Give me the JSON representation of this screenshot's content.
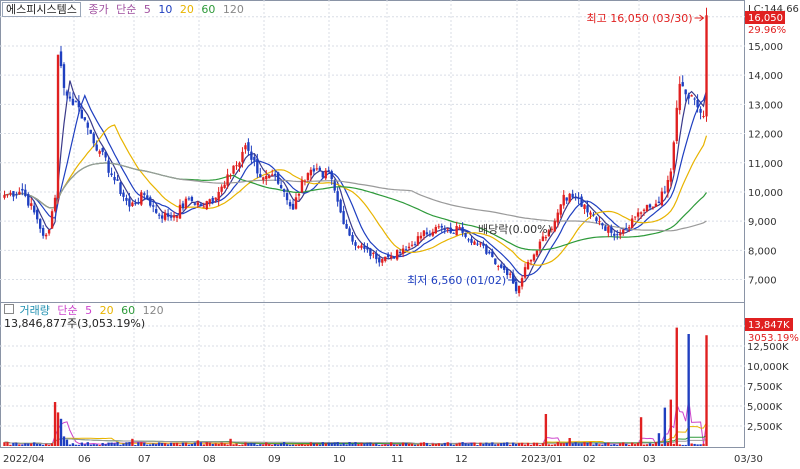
{
  "stock_name": "에스피시스템스",
  "price_legend": {
    "label": "종가",
    "kind": "단순",
    "periods": [
      "5",
      "10",
      "20",
      "60",
      "120"
    ]
  },
  "volume_legend": {
    "label": "거래량",
    "kind": "단순",
    "periods": [
      "5",
      "20",
      "60",
      "120"
    ],
    "summary": "13,846,877주(3,053.19%)"
  },
  "colors": {
    "up": "#e02020",
    "down": "#1f3fc0",
    "ma5": "#3a3a8a",
    "ma10": "#1f3fc0",
    "ma20": "#e8b400",
    "ma60": "#2e9a3a",
    "ma120": "#9a9a9a",
    "vma5": "#cc44cc",
    "vma20": "#e8b400",
    "vma60": "#2e9a3a",
    "vma120": "#9a9a9a"
  },
  "annotations": {
    "high": "최고 16,050 (03/30)",
    "low": "최저 6,560 (01/02)",
    "dividend": "배당락(0.00%)",
    "lc_tag": "LC:144.66",
    "price_tag": "16,050",
    "pct_tag": "29.96%",
    "vol_tag": "13,847K",
    "vol_pct_tag": "3053.19%"
  },
  "chart_data": {
    "type": "candlestick",
    "x_labels": [
      "2022/04",
      "06",
      "07",
      "08",
      "09",
      "10",
      "11",
      "12",
      "2023/01",
      "02",
      "03",
      "03/30"
    ],
    "price_axis": {
      "ticks": [
        "16,000",
        "15,000",
        "14,000",
        "13,000",
        "12,000",
        "11,000",
        "10,000",
        "9,000",
        "8,000",
        "7,000"
      ],
      "ylim": [
        6300,
        16300
      ]
    },
    "volume_axis": {
      "ticks": [
        "15,000K",
        "12,500K",
        "10,000K",
        "7,500K",
        "5,000K",
        "2,500K"
      ],
      "ylim": [
        0,
        16000
      ]
    },
    "close_anchors": [
      [
        0,
        9900
      ],
      [
        6,
        10050
      ],
      [
        10,
        9300
      ],
      [
        13,
        8500
      ],
      [
        15,
        8700
      ],
      [
        17,
        9800
      ],
      [
        18,
        14700
      ],
      [
        21,
        13300
      ],
      [
        25,
        12900
      ],
      [
        28,
        12200
      ],
      [
        32,
        11400
      ],
      [
        37,
        10400
      ],
      [
        42,
        9500
      ],
      [
        47,
        9900
      ],
      [
        52,
        9200
      ],
      [
        57,
        9200
      ],
      [
        62,
        9750
      ],
      [
        67,
        9500
      ],
      [
        72,
        10000
      ],
      [
        75,
        10600
      ],
      [
        77,
        10900
      ],
      [
        79,
        11000
      ],
      [
        81,
        11600
      ],
      [
        83,
        11100
      ],
      [
        86,
        10500
      ],
      [
        90,
        10600
      ],
      [
        94,
        10000
      ],
      [
        97,
        9400
      ],
      [
        100,
        10400
      ],
      [
        104,
        10700
      ],
      [
        107,
        10500
      ],
      [
        109,
        10700
      ],
      [
        113,
        9300
      ],
      [
        117,
        8300
      ],
      [
        121,
        8050
      ],
      [
        125,
        7700
      ],
      [
        130,
        7800
      ],
      [
        135,
        8000
      ],
      [
        140,
        8500
      ],
      [
        145,
        8800
      ],
      [
        150,
        8600
      ],
      [
        153,
        8800
      ],
      [
        158,
        8300
      ],
      [
        163,
        7900
      ],
      [
        167,
        7400
      ],
      [
        170,
        7200
      ],
      [
        172,
        6600
      ],
      [
        176,
        7600
      ],
      [
        180,
        8300
      ],
      [
        185,
        9000
      ],
      [
        188,
        9900
      ],
      [
        192,
        9800
      ],
      [
        196,
        9300
      ],
      [
        200,
        9000
      ],
      [
        204,
        8600
      ],
      [
        208,
        8700
      ],
      [
        213,
        9300
      ],
      [
        218,
        9500
      ],
      [
        222,
        10000
      ],
      [
        224,
        10700
      ],
      [
        227,
        13700
      ],
      [
        230,
        13200
      ],
      [
        233,
        12900
      ],
      [
        235,
        12600
      ],
      [
        236,
        16050
      ]
    ],
    "volume_spikes_k": [
      [
        17,
        5500
      ],
      [
        18,
        4200
      ],
      [
        19,
        3400
      ],
      [
        20,
        1200
      ],
      [
        21,
        800
      ],
      [
        43,
        900
      ],
      [
        65,
        700
      ],
      [
        76,
        900
      ],
      [
        182,
        4000
      ],
      [
        190,
        1000
      ],
      [
        214,
        3600
      ],
      [
        220,
        1600
      ],
      [
        222,
        4800
      ],
      [
        224,
        5800
      ],
      [
        226,
        14800
      ],
      [
        230,
        14000
      ],
      [
        236,
        13847
      ]
    ],
    "bars": 237
  }
}
